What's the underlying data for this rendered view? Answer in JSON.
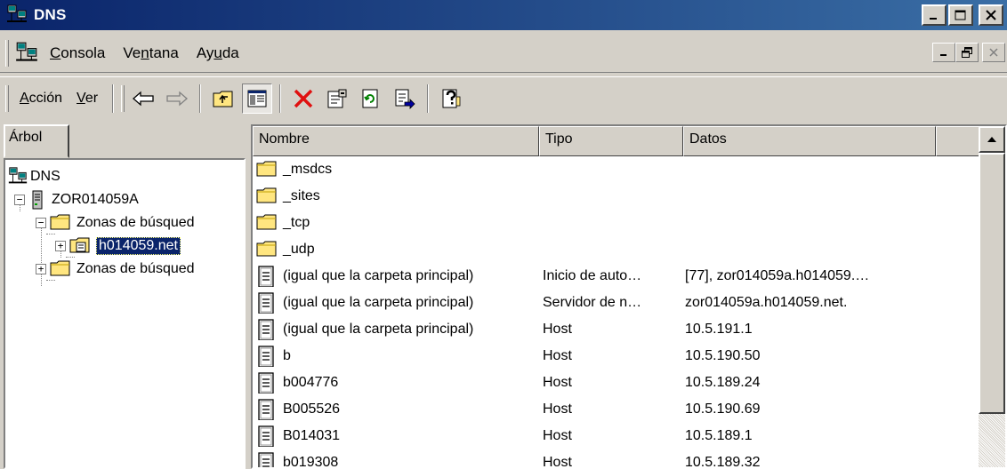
{
  "window": {
    "title": "DNS"
  },
  "menubar": {
    "items": [
      {
        "label": "Consola",
        "ul": "C",
        "rest": "onsola",
        "pre": ""
      },
      {
        "label": "Ventana",
        "pre": "Ve",
        "ul": "n",
        "rest": "tana"
      },
      {
        "label": "Ayuda",
        "pre": "Ay",
        "ul": "u",
        "rest": "da"
      }
    ]
  },
  "toolbar": {
    "accion": {
      "pre": "",
      "ul": "A",
      "rest": "cción"
    },
    "ver": {
      "pre": "",
      "ul": "V",
      "rest": "er"
    }
  },
  "tree": {
    "tab_label": "Árbol",
    "nodes": [
      {
        "label": "DNS",
        "icon": "dns-icon"
      },
      {
        "label": "ZOR014059A",
        "icon": "server-icon",
        "expander": "−"
      },
      {
        "label": "Zonas de búsqued",
        "icon": "folder-icon",
        "expander": "−"
      },
      {
        "label": "h014059.net",
        "icon": "zone-icon",
        "expander": "+",
        "selected": true
      },
      {
        "label": "Zonas de búsqued",
        "icon": "folder-icon",
        "expander": "+"
      }
    ]
  },
  "list": {
    "headers": {
      "nombre": "Nombre",
      "tipo": "Tipo",
      "datos": "Datos"
    },
    "rows": [
      {
        "nombre": "_msdcs",
        "tipo": "",
        "datos": "",
        "icon": "folder-icon"
      },
      {
        "nombre": "_sites",
        "tipo": "",
        "datos": "",
        "icon": "folder-icon"
      },
      {
        "nombre": "_tcp",
        "tipo": "",
        "datos": "",
        "icon": "folder-icon"
      },
      {
        "nombre": "_udp",
        "tipo": "",
        "datos": "",
        "icon": "folder-icon"
      },
      {
        "nombre": "(igual que la carpeta principal)",
        "tipo": "Inicio de auto…",
        "datos": "[77], zor014059a.h014059.…",
        "icon": "record-icon"
      },
      {
        "nombre": "(igual que la carpeta principal)",
        "tipo": "Servidor de n…",
        "datos": "zor014059a.h014059.net.",
        "icon": "record-icon"
      },
      {
        "nombre": "(igual que la carpeta principal)",
        "tipo": "Host",
        "datos": "10.5.191.1",
        "icon": "record-icon"
      },
      {
        "nombre": "b",
        "tipo": "Host",
        "datos": "10.5.190.50",
        "icon": "record-icon"
      },
      {
        "nombre": "b004776",
        "tipo": "Host",
        "datos": "10.5.189.24",
        "icon": "record-icon"
      },
      {
        "nombre": "B005526",
        "tipo": "Host",
        "datos": "10.5.190.69",
        "icon": "record-icon"
      },
      {
        "nombre": "B014031",
        "tipo": "Host",
        "datos": "10.5.189.1",
        "icon": "record-icon"
      },
      {
        "nombre": "b019308",
        "tipo": "Host",
        "datos": "10.5.189.32",
        "icon": "record-icon"
      }
    ]
  },
  "colors": {
    "titlebar_start": "#0a246a",
    "titlebar_end": "#3a6ea5",
    "face": "#d4d0c8",
    "folder": "#ffe680",
    "delete": "#e01010"
  }
}
